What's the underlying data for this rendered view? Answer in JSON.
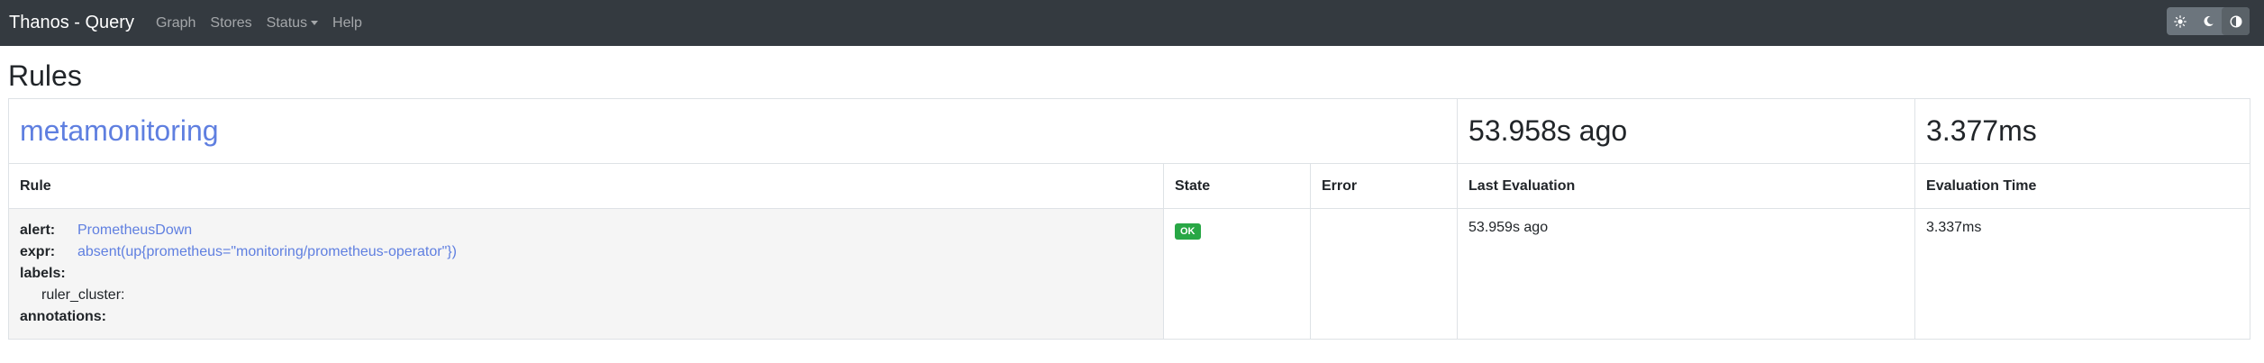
{
  "navbar": {
    "brand": "Thanos - Query",
    "links": [
      "Graph",
      "Stores",
      "Status",
      "Help"
    ],
    "theme_icons": [
      "sun-icon",
      "moon-icon",
      "contrast-icon"
    ]
  },
  "page": {
    "title": "Rules"
  },
  "group": {
    "name": "metamonitoring",
    "last_evaluation": "53.958s ago",
    "evaluation_time": "3.377ms"
  },
  "table": {
    "headers": [
      "Rule",
      "State",
      "Error",
      "Last Evaluation",
      "Evaluation Time"
    ]
  },
  "rule": {
    "alert_key": "alert:",
    "alert_value": "PrometheusDown",
    "expr_key": "expr:",
    "expr_value": "absent(up{prometheus=\"monitoring/prometheus-operator\"})",
    "labels_key": "labels:",
    "label_line": "ruler_cluster:",
    "annotations_key": "annotations:",
    "state": "OK",
    "error": "",
    "last_evaluation": "53.959s ago",
    "evaluation_time": "3.337ms"
  },
  "colors": {
    "navbar_bg": "#343a40",
    "link": "#5f7fe0",
    "ok_badge": "#28a745"
  }
}
